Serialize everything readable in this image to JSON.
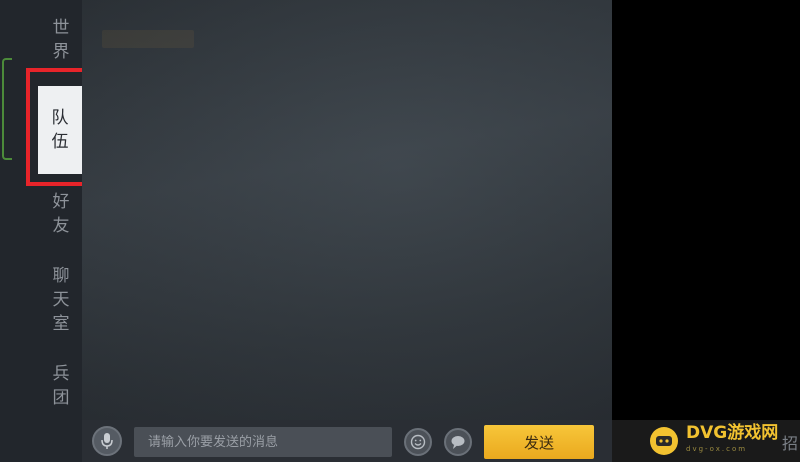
{
  "sidebar": {
    "tabs": [
      {
        "id": "world",
        "chars": [
          "世",
          "界"
        ]
      },
      {
        "id": "team",
        "chars": [
          "队",
          "伍"
        ],
        "active": true
      },
      {
        "id": "friends",
        "chars": [
          "好",
          "友"
        ]
      },
      {
        "id": "chatroom",
        "chars": [
          "聊",
          "天",
          "室"
        ]
      },
      {
        "id": "legion",
        "chars": [
          "兵",
          "团"
        ]
      }
    ]
  },
  "input_bar": {
    "placeholder": "请输入你要发送的消息",
    "send_label": "发送",
    "mic_icon": "microphone-icon",
    "emoji_icon": "emoji-icon",
    "quick_chat_icon": "speech-bubble-icon"
  },
  "watermark": {
    "logo_icon": "gamepad-icon",
    "brand": "DVG游戏网",
    "sub": "dvg-ox.com",
    "cut_char": "招"
  },
  "colors": {
    "highlight": "#e8242a",
    "send_button": "#f2b92c",
    "brand_yellow": "#f2c230"
  }
}
